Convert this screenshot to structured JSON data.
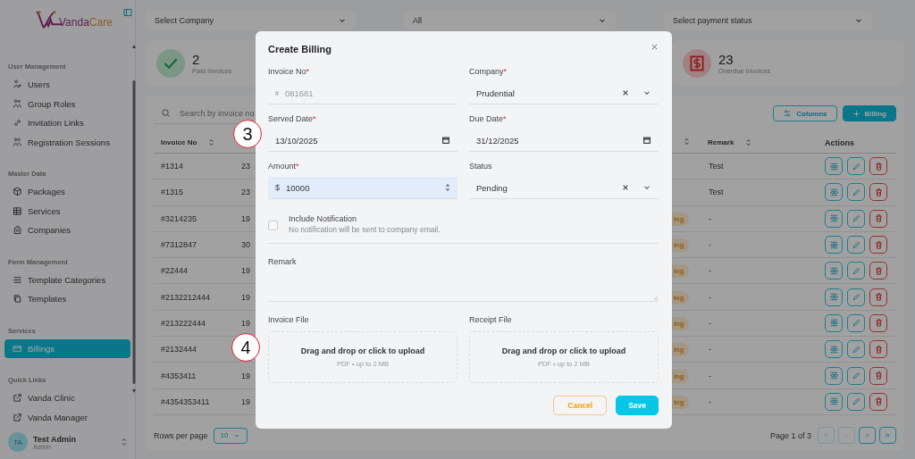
{
  "sidebar": {
    "logo": {
      "name_start": "Vanda",
      "name_end": "Care"
    },
    "sections": [
      {
        "title": "User Management",
        "items": [
          {
            "label": "Users",
            "selected": false
          },
          {
            "label": "Group Roles",
            "selected": false
          },
          {
            "label": "Invitation Links",
            "selected": false
          },
          {
            "label": "Registration Sessions",
            "selected": false
          }
        ]
      },
      {
        "title": "Master Data",
        "items": [
          {
            "label": "Packages",
            "selected": false
          },
          {
            "label": "Services",
            "selected": false
          },
          {
            "label": "Companies",
            "selected": false
          }
        ]
      },
      {
        "title": "Form Management",
        "items": [
          {
            "label": "Template Categories",
            "selected": false
          },
          {
            "label": "Templates",
            "selected": false
          }
        ]
      },
      {
        "title": "Services",
        "items": [
          {
            "label": "Billings",
            "selected": true
          }
        ]
      },
      {
        "title": "Quick Links",
        "items": [
          {
            "label": "Vanda Clinic",
            "selected": false
          },
          {
            "label": "Vanda Manager",
            "selected": false
          }
        ]
      }
    ],
    "user": {
      "initials": "TA",
      "name": "Test Admin",
      "role": "Admin"
    }
  },
  "filters": [
    {
      "value": "Select Company"
    },
    {
      "value": "All"
    },
    {
      "value": "Select payment status"
    }
  ],
  "stats": [
    {
      "value": "2",
      "label": "Paid Invoices",
      "kind": "paid"
    },
    {
      "value": "23",
      "label": "Overdue Invoices",
      "kind": "overdue"
    }
  ],
  "table": {
    "search": {
      "placeholder": "Search by invoice no"
    },
    "buttons": [
      {
        "label": "Columns",
        "kind": "outline"
      },
      {
        "label": "Billing",
        "kind": "primary"
      }
    ],
    "columns": [
      {
        "label": "Invoice No",
        "sortable": true
      },
      {
        "sortable": true
      },
      {
        "label": "Remark",
        "sortable": true
      },
      {
        "label": "Actions",
        "sortable": false
      }
    ],
    "rows": [
      {
        "invoice_no": "#1314",
        "column_2": "23",
        "remark": "Test"
      },
      {
        "invoice_no": "#1315",
        "column_2": "23",
        "remark": "Test"
      },
      {
        "invoice_no": "#3214235",
        "column_2": "19",
        "status": "ing",
        "remark": "-"
      },
      {
        "invoice_no": "#7312847",
        "column_2": "30",
        "status": "ing",
        "remark": "-"
      },
      {
        "invoice_no": "#22444",
        "column_2": "19",
        "status": "ing",
        "remark": "-"
      },
      {
        "invoice_no": "#2132212444",
        "column_2": "19",
        "status": "ing",
        "remark": "-"
      },
      {
        "invoice_no": "#213222444",
        "column_2": "19",
        "status": "ing",
        "remark": "-"
      },
      {
        "invoice_no": "#2132444",
        "status": "ing",
        "remark": "-"
      },
      {
        "invoice_no": "#4353411",
        "column_2": "19",
        "status": "ing",
        "remark": "-"
      },
      {
        "invoice_no": "#4354353411",
        "column_2": "19",
        "status": "ing",
        "remark": "-"
      }
    ],
    "rows_per_page_label": "Rows per page",
    "rows_per_page": "10",
    "page_info": "Page 1 of 3",
    "pager": [
      {
        "disabled": true
      },
      {
        "disabled": true
      },
      {
        "disabled": false
      },
      {
        "disabled": false
      }
    ]
  },
  "modal": {
    "title": "Create Billing",
    "fields": [
      {
        "label": "Invoice No",
        "required_mark": "*",
        "kind": "text",
        "prefix": "#",
        "placeholder": "081681",
        "focused": false
      },
      {
        "label": "Company",
        "required_mark": "*",
        "kind": "select",
        "value": "Prudential",
        "focused": false
      },
      {
        "label": "Served Date",
        "required_mark": "*",
        "kind": "date",
        "value": "13/10/2025",
        "focused": false
      },
      {
        "label": "Due Date",
        "required_mark": "*",
        "kind": "date",
        "value": "31/12/2025",
        "focused": false
      },
      {
        "label": "Amount",
        "required_mark": "*",
        "kind": "number",
        "prefix": "$",
        "value": "10000",
        "focused": true
      },
      {
        "label": "Status",
        "kind": "select",
        "value": "Pending",
        "focused": false
      }
    ],
    "notification": {
      "label": "Include Notification",
      "hint": "No notification will be sent to company email.",
      "checked": false
    },
    "remark": {
      "label": "Remark"
    },
    "uploads": [
      {
        "label": "Invoice File",
        "prompt": "Drag and drop or click to upload",
        "hint": "PDF • up to 2 MB"
      },
      {
        "label": "Receipt File",
        "prompt": "Drag and drop or click to upload",
        "hint": "PDF • up to 2 MB"
      }
    ],
    "actions": [
      {
        "label": "Cancel",
        "kind": "cancel"
      },
      {
        "label": "Save",
        "kind": "save"
      }
    ]
  },
  "callouts": [
    {
      "label": "3"
    },
    {
      "label": "4"
    }
  ]
}
